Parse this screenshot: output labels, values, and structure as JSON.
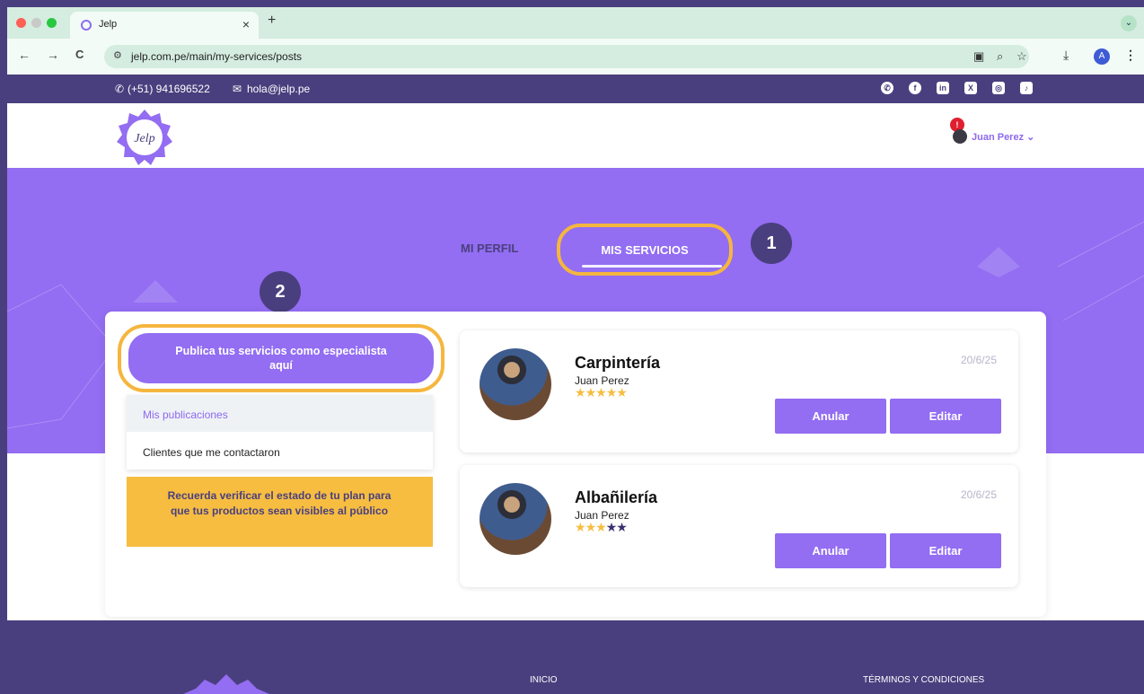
{
  "browser": {
    "tab_title": "Jelp",
    "tab_close": "×",
    "new_tab": "+",
    "menu_toggle": "⌄",
    "url": "jelp.com.pe/main/my-services/posts",
    "back": "←",
    "forward": "→",
    "reload": "C",
    "profile_initial": "A"
  },
  "topbar": {
    "phone": "(+51) 941696522",
    "email": "hola@jelp.pe",
    "socials": [
      "whatsapp",
      "facebook",
      "linkedin",
      "x",
      "instagram",
      "tiktok"
    ]
  },
  "header": {
    "logo_text": "Jelp",
    "user_name": "Juan Perez",
    "notification_count": "!"
  },
  "profile_tabs": {
    "profile": "MI PERFIL",
    "services": "MIS SERVICIOS"
  },
  "step_badges": [
    "1",
    "2"
  ],
  "sidebar": {
    "publish_label": "Publica tus servicios como especialista aquí",
    "menu": [
      {
        "label": "Mis publicaciones",
        "active": true
      },
      {
        "label": "Clientes que me contactaron",
        "active": false
      }
    ],
    "plan_note": "Recuerda verificar el estado de tu plan para que tus productos sean visibles al público"
  },
  "services": [
    {
      "title": "Carpintería",
      "author": "Juan Perez",
      "date": "20/6/25",
      "rating": 5,
      "cancel_label": "Anular",
      "edit_label": "Editar"
    },
    {
      "title": "Albañilería",
      "author": "Juan Perez",
      "date": "20/6/25",
      "rating": 3,
      "cancel_label": "Anular",
      "edit_label": "Editar"
    }
  ],
  "footer": {
    "links": [
      "INICIO",
      "TÉRMINOS Y CONDICIONES"
    ]
  },
  "colors": {
    "brand_purple": "#936df2",
    "dark_purple": "#4a3f7e",
    "highlight_orange": "#f5b63e",
    "note_yellow": "#f6bd41"
  }
}
